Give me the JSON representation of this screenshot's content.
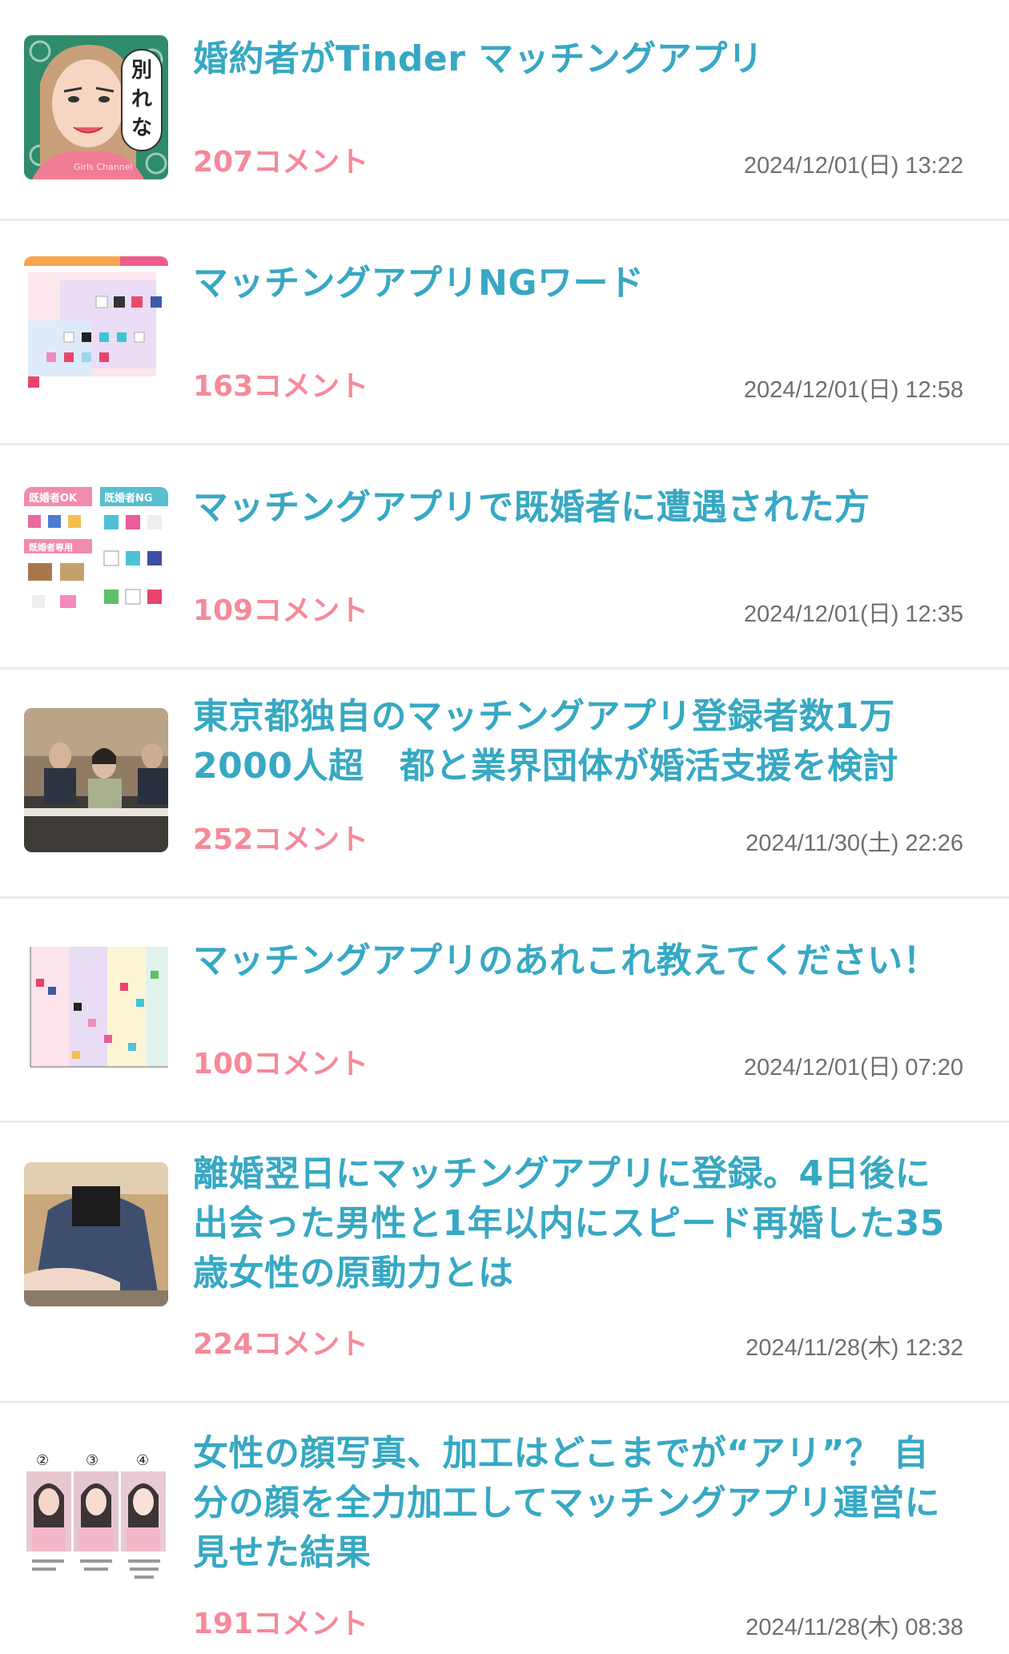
{
  "articles": [
    {
      "title": "婚約者がTinder マッチングアプリ",
      "comments": "207コメント",
      "date": "2024/12/01(日) 13:22",
      "thumbnail_text": "別れな",
      "thumbnail_caption": "Girls Channel"
    },
    {
      "title": "マッチングアプリNGワード",
      "comments": "163コメント",
      "date": "2024/12/01(日) 12:58"
    },
    {
      "title": "マッチングアプリで既婚者に遭遇された方",
      "comments": "109コメント",
      "date": "2024/12/01(日) 12:35",
      "thumbnail_labels": [
        "既婚者OK",
        "既婚者NG",
        "既婚者専用"
      ]
    },
    {
      "title": "東京都独自のマッチングアプリ登録者数1万2000人超　都と業界団体が婚活支援を検討",
      "comments": "252コメント",
      "date": "2024/11/30(土) 22:26"
    },
    {
      "title": "マッチングアプリのあれこれ教えてください！",
      "comments": "100コメント",
      "date": "2024/12/01(日) 07:20"
    },
    {
      "title": "離婚翌日にマッチングアプリに登録。4日後に出会った男性と1年以内にスピード再婚した35歳女性の原動力とは",
      "comments": "224コメント",
      "date": "2024/11/28(木) 12:32"
    },
    {
      "title": "女性の顔写真、加工はどこまでが“アリ”？ 自分の顔を全力加工してマッチングアプリ運営に見せた結果",
      "comments": "191コメント",
      "date": "2024/11/28(木) 08:38",
      "thumbnail_labels": [
        "②",
        "③",
        "④"
      ]
    }
  ],
  "colors": {
    "title": "#37a8c3",
    "comments": "#f58a9a",
    "date": "#6f6f6f",
    "divider": "#ececec"
  }
}
